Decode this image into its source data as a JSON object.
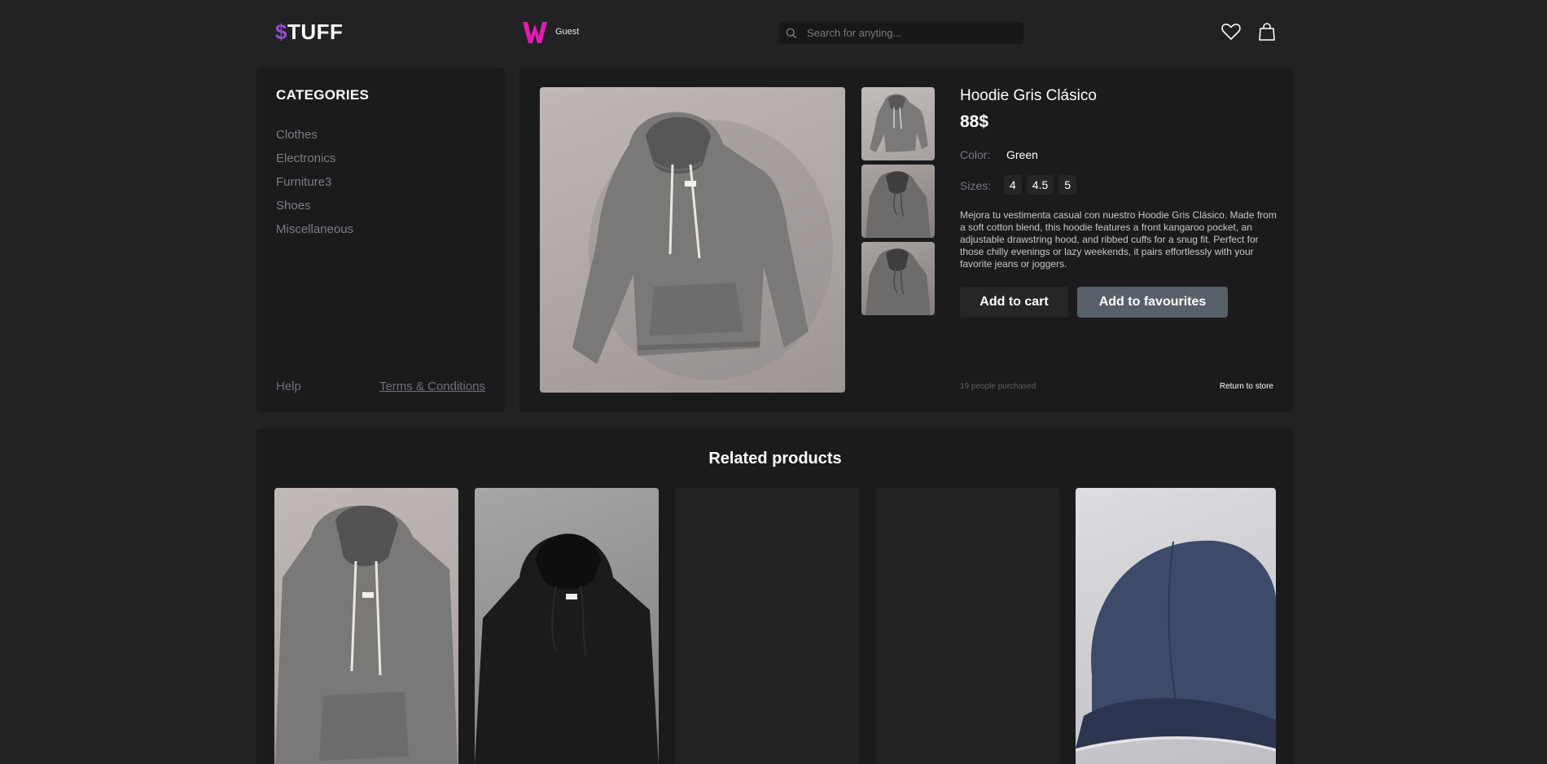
{
  "header": {
    "logo_symbol": "$",
    "logo_text": "TUFF",
    "user_name": "Guest",
    "search_placeholder": "Search for anyting...",
    "icons": [
      "search-icon",
      "heart-icon",
      "bag-icon"
    ]
  },
  "sidebar": {
    "title": "CATEGORIES",
    "items": [
      "Clothes",
      "Electronics",
      "Furniture3",
      "Shoes",
      "Miscellaneous"
    ],
    "help": "Help",
    "terms": "Terms & Conditions"
  },
  "product": {
    "title": "Hoodie Gris Clásico",
    "price": "88$",
    "color_label": "Color:",
    "color_value": "Green",
    "sizes_label": "Sizes:",
    "sizes": [
      "4",
      "4.5",
      "5"
    ],
    "description": "Mejora tu vestimenta casual con nuestro Hoodie Gris Clásico. Made from a soft cotton blend, this hoodie features a front kangaroo pocket, an adjustable drawstring hood, and ribbed cuffs for a snug fit. Perfect for those chilly evenings or lazy weekends, it pairs effortlessly with your favorite jeans or joggers.",
    "add_to_cart": "Add to cart",
    "add_to_favourites": "Add to favourites",
    "purchased": "19 people purchased",
    "return": "Return to store"
  },
  "related": {
    "title": "Related products"
  },
  "colors": {
    "background": "#222225",
    "panel": "#1b1b1d",
    "accent": "#944bd6",
    "avatar": "#e11cb0",
    "favourites_button": "#576068"
  }
}
